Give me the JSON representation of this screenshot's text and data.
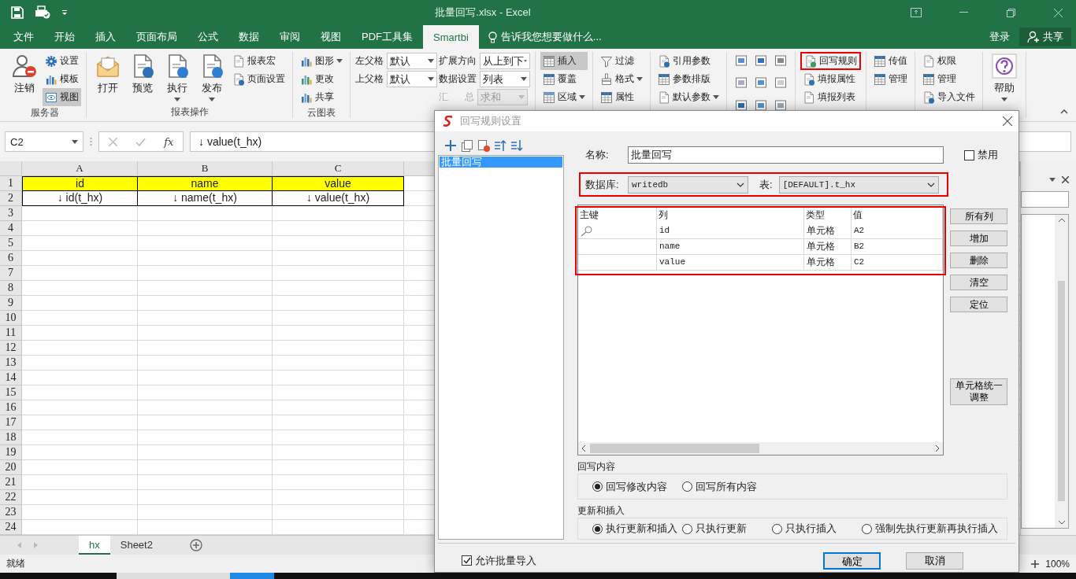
{
  "window": {
    "title": "批量回写.xlsx - Excel"
  },
  "menu_tabs": [
    {
      "label": "文件",
      "selected": false
    },
    {
      "label": "开始",
      "selected": false
    },
    {
      "label": "插入",
      "selected": false
    },
    {
      "label": "页面布局",
      "selected": false
    },
    {
      "label": "公式",
      "selected": false
    },
    {
      "label": "数据",
      "selected": false
    },
    {
      "label": "审阅",
      "selected": false
    },
    {
      "label": "视图",
      "selected": false
    },
    {
      "label": "PDF工具集",
      "selected": false
    },
    {
      "label": "Smartbi",
      "selected": true
    }
  ],
  "tell_me": "告诉我您想要做什么...",
  "sign_in": "登录",
  "share": "共享",
  "ribbon": {
    "groups": [
      {
        "kind": "buttons",
        "label": "服务器",
        "columns": [
          [
            {
              "kind": "large",
              "label": "注销",
              "pressed": false,
              "marked": false
            }
          ],
          [
            {
              "kind": "small",
              "label": "设置",
              "pressed": false,
              "marked": false
            },
            {
              "kind": "small",
              "label": "模板",
              "pressed": false,
              "marked": false
            },
            {
              "kind": "small",
              "label": "视图",
              "pressed": true,
              "marked": false
            }
          ]
        ]
      },
      {
        "kind": "buttons",
        "label": "报表操作",
        "columns": [
          [
            {
              "kind": "large",
              "label": "打开",
              "pressed": false,
              "marked": false
            }
          ],
          [
            {
              "kind": "large",
              "label": "预览",
              "pressed": false,
              "marked": false
            }
          ],
          [
            {
              "kind": "large_menu",
              "label": "执行",
              "pressed": false,
              "marked": false
            }
          ],
          [
            {
              "kind": "large_menu",
              "label": "发布",
              "pressed": false,
              "marked": false
            }
          ],
          [
            {
              "kind": "small",
              "label": "报表宏",
              "pressed": false,
              "marked": false
            },
            {
              "kind": "small",
              "label": "页面设置",
              "pressed": false,
              "marked": false
            }
          ]
        ]
      },
      {
        "kind": "buttons",
        "label": "云图表",
        "columns": [
          [
            {
              "kind": "small_menu",
              "label": "图形",
              "pressed": false,
              "marked": false
            },
            {
              "kind": "small",
              "label": "更改",
              "pressed": false,
              "marked": false
            },
            {
              "kind": "small",
              "label": "共享",
              "pressed": false,
              "marked": false
            }
          ]
        ]
      },
      {
        "kind": "buttons",
        "columns": [
          [
            {
              "kind": "field",
              "label": "左父格",
              "value": "默认",
              "disabled": false
            },
            {
              "kind": "field",
              "label": "上父格",
              "value": "默认",
              "disabled": false
            }
          ],
          [
            {
              "kind": "field",
              "label": "扩展方向",
              "value": "从上到下",
              "disabled": false
            },
            {
              "kind": "field",
              "label": "数据设置",
              "value": "列表",
              "disabled": false
            },
            {
              "kind": "field",
              "label": "汇 总",
              "value": "求和",
              "disabled": true
            }
          ]
        ]
      },
      {
        "kind": "buttons",
        "columns": [
          [
            {
              "kind": "small",
              "label": "插入",
              "pressed": true,
              "marked": false
            },
            {
              "kind": "small",
              "label": "覆盖",
              "pressed": false,
              "marked": false
            },
            {
              "kind": "small_menu",
              "label": "区域",
              "pressed": false,
              "marked": false
            }
          ]
        ]
      },
      {
        "kind": "buttons",
        "columns": [
          [
            {
              "kind": "small",
              "label": "过滤",
              "pressed": false,
              "marked": false
            },
            {
              "kind": "small_menu",
              "label": "格式",
              "pressed": false,
              "marked": false
            },
            {
              "kind": "small",
              "label": "属性",
              "pressed": false,
              "marked": false
            }
          ]
        ]
      },
      {
        "kind": "buttons",
        "columns": [
          [
            {
              "kind": "small",
              "label": "引用参数",
              "pressed": false,
              "marked": false
            },
            {
              "kind": "small",
              "label": "参数排版",
              "pressed": false,
              "marked": false
            },
            {
              "kind": "small_menu",
              "label": "默认参数",
              "pressed": false,
              "marked": false
            }
          ]
        ]
      },
      {
        "kind": "icon_grid"
      },
      {
        "kind": "buttons",
        "columns": [
          [
            {
              "kind": "small",
              "label": "回写规则",
              "pressed": false,
              "marked": true
            },
            {
              "kind": "small",
              "label": "填报属性",
              "pressed": false,
              "marked": false
            },
            {
              "kind": "small",
              "label": "填报列表",
              "pressed": false,
              "marked": false
            }
          ]
        ]
      },
      {
        "kind": "buttons",
        "columns": [
          [
            {
              "kind": "small",
              "label": "传值",
              "pressed": false,
              "marked": false
            },
            {
              "kind": "small",
              "label": "管理",
              "pressed": false,
              "marked": false
            }
          ]
        ]
      },
      {
        "kind": "buttons",
        "columns": [
          [
            {
              "kind": "small",
              "label": "权限",
              "pressed": false,
              "marked": false
            },
            {
              "kind": "small",
              "label": "管理",
              "pressed": false,
              "marked": false
            },
            {
              "kind": "small",
              "label": "导入文件",
              "pressed": false,
              "marked": false
            }
          ]
        ]
      },
      {
        "kind": "buttons",
        "columns": [
          [
            {
              "kind": "large_menu",
              "label": "帮助",
              "pressed": false,
              "marked": false
            }
          ]
        ]
      }
    ]
  },
  "formula_bar": {
    "name_box": "C2",
    "function_label": "fx",
    "formula": "↓ value(t_hx)"
  },
  "sheet": {
    "columns": [
      "A",
      "B",
      "C"
    ],
    "rows": [
      {
        "number": "1",
        "kind": "header",
        "cells": [
          "id",
          "name",
          "value"
        ]
      },
      {
        "number": "2",
        "kind": "data",
        "cells": [
          "↓ id(t_hx)",
          "↓ name(t_hx)",
          "↓ value(t_hx)"
        ]
      },
      {
        "number": "3",
        "kind": "empty"
      },
      {
        "number": "4",
        "kind": "empty"
      },
      {
        "number": "5",
        "kind": "empty"
      },
      {
        "number": "6",
        "kind": "empty"
      },
      {
        "number": "7",
        "kind": "empty"
      },
      {
        "number": "8",
        "kind": "empty"
      },
      {
        "number": "9",
        "kind": "empty"
      },
      {
        "number": "10",
        "kind": "empty"
      },
      {
        "number": "11",
        "kind": "empty"
      },
      {
        "number": "12",
        "kind": "empty"
      },
      {
        "number": "13",
        "kind": "empty"
      },
      {
        "number": "14",
        "kind": "empty"
      },
      {
        "number": "15",
        "kind": "empty"
      },
      {
        "number": "16",
        "kind": "empty"
      },
      {
        "number": "17",
        "kind": "empty"
      },
      {
        "number": "18",
        "kind": "empty"
      },
      {
        "number": "19",
        "kind": "empty"
      },
      {
        "number": "20",
        "kind": "empty"
      },
      {
        "number": "21",
        "kind": "empty"
      },
      {
        "number": "22",
        "kind": "empty"
      },
      {
        "number": "23",
        "kind": "empty"
      },
      {
        "number": "24",
        "kind": "empty"
      }
    ]
  },
  "sheet_tabs": [
    {
      "label": "hx",
      "selected": true
    },
    {
      "label": "Sheet2",
      "selected": false
    }
  ],
  "status_bar": {
    "status": "就绪",
    "zoom": "100%"
  },
  "dialog": {
    "title": "回写规则设置",
    "rules": [
      {
        "label": "批量回写",
        "selected": true
      }
    ],
    "name_label": "名称:",
    "name_value": "批量回写",
    "disable_option": {
      "label": "禁用",
      "checked": false
    },
    "source_marked": true,
    "database": {
      "label": "数据库:",
      "value": "writedb"
    },
    "table": {
      "label": "表:",
      "value": "[DEFAULT].t_hx"
    },
    "grid_marked": true,
    "grid": {
      "columns": [
        "主键",
        "列",
        "类型",
        "值"
      ],
      "rows": [
        {
          "primary_key": true,
          "column": "id",
          "type": "单元格",
          "value": "A2"
        },
        {
          "primary_key": false,
          "column": "name",
          "type": "单元格",
          "value": "B2"
        },
        {
          "primary_key": false,
          "column": "value",
          "type": "单元格",
          "value": "C2"
        }
      ]
    },
    "side_buttons": [
      "所有列",
      "增加",
      "删除",
      "清空",
      "定位",
      "单元格统一调整"
    ],
    "write_back": {
      "label": "回写内容",
      "options": [
        {
          "label": "回写修改内容",
          "selected": true
        },
        {
          "label": "回写所有内容",
          "selected": false
        }
      ]
    },
    "update_insert": {
      "label": "更新和插入",
      "options": [
        {
          "label": "执行更新和插入",
          "selected": true
        },
        {
          "label": "只执行更新",
          "selected": false
        },
        {
          "label": "只执行插入",
          "selected": false
        },
        {
          "label": "强制先执行更新再执行插入",
          "selected": false
        }
      ]
    },
    "batch_import": {
      "label": "允许批量导入",
      "checked": true
    },
    "buttons": [
      {
        "label": "确定",
        "default": true
      },
      {
        "label": "取消",
        "default": false
      }
    ]
  }
}
